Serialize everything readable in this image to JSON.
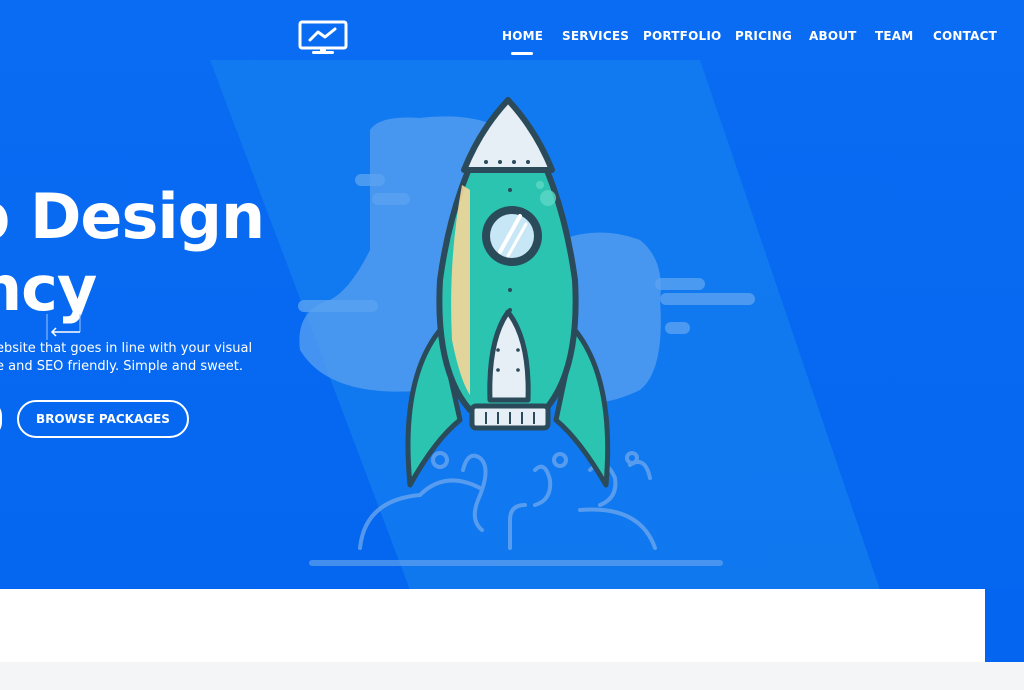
{
  "nav": {
    "items": [
      {
        "label": "HOME",
        "active": true
      },
      {
        "label": "SERVICES",
        "active": false
      },
      {
        "label": "PORTFOLIO",
        "active": false
      },
      {
        "label": "PRICING",
        "active": false
      },
      {
        "label": "ABOUT",
        "active": false
      },
      {
        "label": "TEAM",
        "active": false
      },
      {
        "label": "CONTACT",
        "active": false
      }
    ],
    "logo_icon": "monitor-chart-icon"
  },
  "hero": {
    "headline_line1": "b Design",
    "headline_line2": "ncy",
    "subtext_line1": "ebsite that goes in line with your visual",
    "subtext_line2": "e and SEO friendly. Simple and sweet.",
    "browse_button": "BROWSE PACKAGES",
    "illustration": "rocket-launch-icon"
  },
  "colors": {
    "hero_blue": "#0a6cf2",
    "rocket_teal": "#2bc4b0",
    "rocket_outline": "#2b4a5a",
    "cloud": "#5aa2f2",
    "page_bg": "#f4f5f7"
  }
}
